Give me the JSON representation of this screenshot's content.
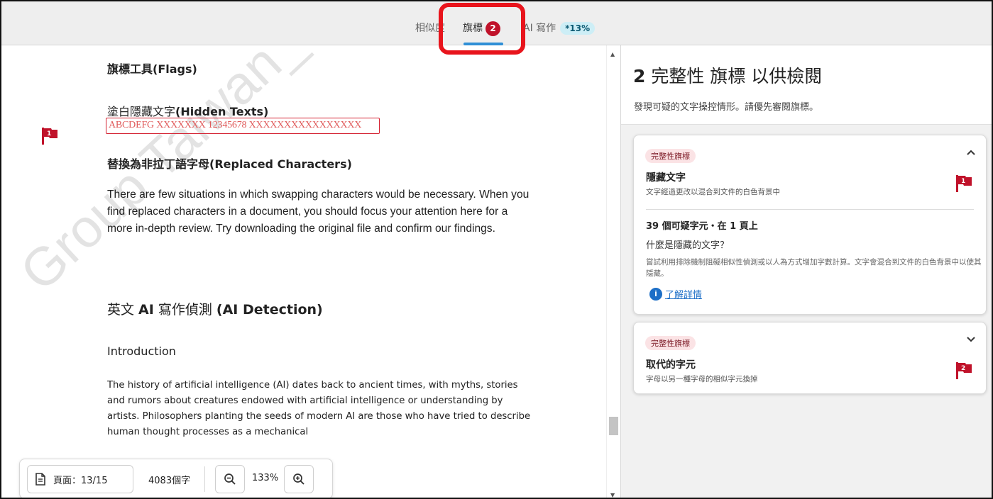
{
  "tabs": {
    "similarity": {
      "label": "相似度"
    },
    "flags": {
      "label": "旗標",
      "count": "2"
    },
    "ai": {
      "label": "AI 寫作",
      "badge": "*13%"
    }
  },
  "document": {
    "watermark": "Group Taiwan_FairTher",
    "flags_heading": "旗標工具(Flags)",
    "hidden_heading_zh": "塗白隱藏文字",
    "hidden_heading_en": "(Hidden Texts)",
    "hidden_text_sample": "ABCDEFG XXXXXXX 12345678 XXXXXXXXXXXXXXXX",
    "flag_number": "1",
    "replaced_heading": "替換為非拉丁語字母(Replaced Characters)",
    "replaced_paragraph": "There are few situations in which swapping characters would be necessary. When you find replaced characters in a document, you should focus your attention here for a more in-depth review. Try downloading the original file and confirm our findings.",
    "ai_heading_zh": "英文 ",
    "ai_heading_ai": "AI",
    "ai_heading_zh2": " 寫作偵測 ",
    "ai_heading_en": "(AI Detection)",
    "intro_heading": "Introduction",
    "intro_paragraph": "The history of artificial intelligence (AI) dates back to ancient times, with myths, stories and rumors about creatures endowed with artificial intelligence or understanding by artists. Philosophers planting the seeds of modern AI are those who have tried to describe human thought processes as a mechanical"
  },
  "toolbar": {
    "page_label": "頁面：13/15",
    "word_count": "4083個字",
    "zoom_level": "133%"
  },
  "panel": {
    "title_count": "2",
    "title_text": " 完整性 旗標 以供檢閱",
    "subtitle": "發現可疑的文字操控情形。請優先審閱旗標。",
    "cards": [
      {
        "pill": "完整性旗標",
        "title": "隱藏文字",
        "desc": "文字經過更改以混合到文件的白色背景中",
        "flag_number": "1",
        "suspicious": "39 個可疑字元・在 1 頁上",
        "question": "什麼是隱藏的文字？",
        "explanation": "嘗試利用排除機制阻礙相似性偵測或以人為方式增加字數計算。文字會混合到文件的白色背景中以使其隱藏。",
        "learn_more": "了解詳情"
      },
      {
        "pill": "完整性旗標",
        "title": "取代的字元",
        "desc": "字母以另一種字母的相似字元換掉",
        "flag_number": "2"
      }
    ]
  },
  "colors": {
    "flag_red": "#c0122a",
    "highlight_red": "#e8141c",
    "link_blue": "#1d6fc7",
    "ai_badge_bg": "#cdeef6",
    "tab_underline": "#2f8fd6"
  }
}
